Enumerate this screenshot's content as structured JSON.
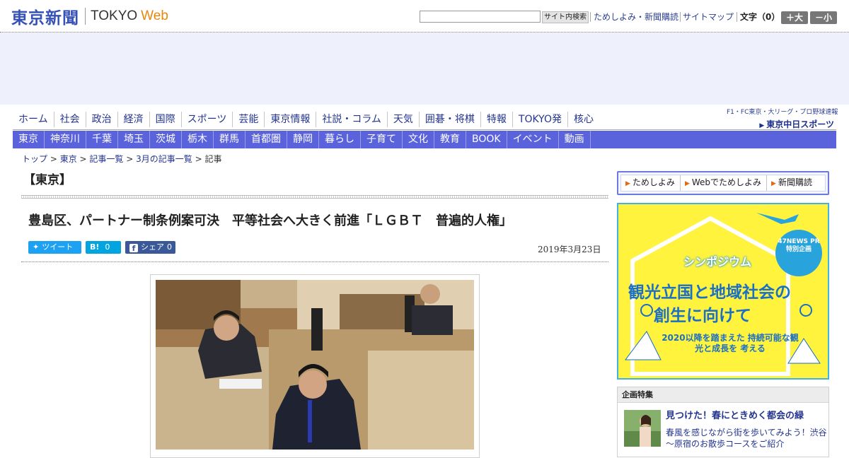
{
  "header": {
    "logo_jp": "東京新聞",
    "logo_tokyo": "TOKYO",
    "logo_web": "Web",
    "search_button": "サイト内検索",
    "links": [
      "ためしよみ・新聞購読",
      "サイトマップ"
    ],
    "font_label": "文字（0）",
    "font_larger": "＋大",
    "font_smaller": "－小"
  },
  "nav_primary": [
    "ホーム",
    "社会",
    "政治",
    "経済",
    "国際",
    "スポーツ",
    "芸能",
    "東京情報",
    "社説・コラム",
    "天気",
    "囲碁・将棋",
    "特報",
    "TOKYO発",
    "核心"
  ],
  "sports_link": {
    "top": "F1・FC東京・大リーグ・プロ野球速報",
    "logo": "東京中日スポーツ"
  },
  "nav_secondary": [
    "東京",
    "神奈川",
    "千葉",
    "埼玉",
    "茨城",
    "栃木",
    "群馬",
    "首都圏",
    "静岡",
    "暮らし",
    "子育て",
    "文化",
    "教育",
    "BOOK",
    "イベント",
    "動画"
  ],
  "breadcrumb": {
    "items": [
      "トップ",
      "東京",
      "記事一覧",
      "3月の記事一覧"
    ],
    "current": "記事",
    "sep": " > "
  },
  "article": {
    "section": "【東京】",
    "headline": "豊島区、パートナー制条例案可決　平等社会へ大きく前進「ＬＧＢＴ　普遍的人権」",
    "date": "2019年3月23日",
    "share": {
      "tweet": "ツイート",
      "hatena_icon": "B!",
      "hatena_count": "0",
      "fb_label": "シェア",
      "fb_count": "0"
    }
  },
  "sidebar": {
    "links": [
      "ためしよみ",
      "Webでためしよみ",
      "新聞購読"
    ],
    "banner": {
      "badge": "47NEWS PR 特別企画",
      "line1": "シンポジウム",
      "line2": "観光立国と地域社会の",
      "line3": "創生に向けて",
      "line4": "2020以降を踏まえた 持続可能な観光と成長を 考える"
    },
    "feature": {
      "heading": "企画特集",
      "title": "見つけた！春にときめく都会の緑",
      "desc": "春風を感じながら街を歩いてみよう！渋谷～原宿のお散歩コースをご紹介"
    }
  },
  "colors": {
    "brand_blue": "#3550b8",
    "nav_bar": "#5a63dc",
    "accent_orange": "#e8860c",
    "twitter": "#1da1f2",
    "hatena": "#00a4de",
    "facebook": "#3b5998",
    "banner_yellow": "#fff33e"
  }
}
